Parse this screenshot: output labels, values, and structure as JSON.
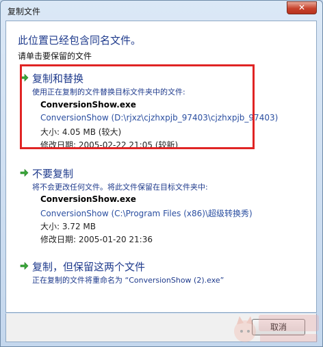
{
  "window": {
    "title": "复制文件",
    "close_glyph": "✕"
  },
  "header": {
    "title": "此位置已经包含同名文件。",
    "subtitle": "请单击要保留的文件"
  },
  "options": [
    {
      "title": "复制和替换",
      "description": "使用正在复制的文件替换目标文件夹中的文件:",
      "file_name": "ConversionShow.exe",
      "path": "ConversionShow (D:\\rjxz\\cjzhxpjb_97403\\cjzhxpjb_97403)",
      "size": "大小: 4.05 MB (较大)",
      "date": "修改日期: 2005-02-22 21:05 (较新)"
    },
    {
      "title": "不要复制",
      "description": "将不会更改任何文件。将此文件保留在目标文件夹中:",
      "file_name": "ConversionShow.exe",
      "path": "ConversionShow (C:\\Program Files (x86)\\超级转换秀)",
      "size": "大小: 3.72 MB",
      "date": "修改日期: 2005-01-20 21:36"
    },
    {
      "title": "复制，但保留这两个文件",
      "description": "正在复制的文件将重命名为 “ConversionShow (2).exe”"
    }
  ],
  "footer": {
    "cancel_label": "取消"
  },
  "colors": {
    "accent": "#1e3a8c",
    "highlight_border": "#e02424",
    "arrow": "#3aa83a"
  }
}
